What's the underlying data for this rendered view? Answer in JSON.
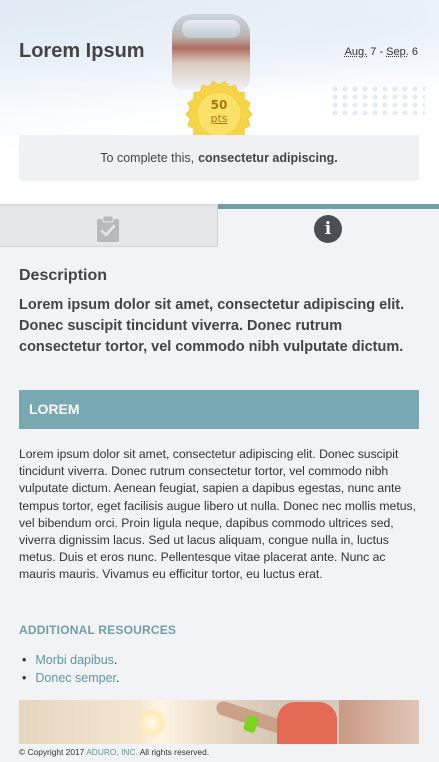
{
  "header": {
    "title": "Lorem Ipsum",
    "date_start_abbr": "Aug.",
    "date_start_day": "7",
    "date_sep": " - ",
    "date_end_abbr": "Sep.",
    "date_end_day": "6"
  },
  "badge": {
    "points": "50",
    "label": "pts"
  },
  "info_box": {
    "prefix": "To complete this,",
    "emphasis": "consectetur adipiscing."
  },
  "tabs": [
    {
      "name": "activity",
      "icon": "clipboard-check-icon",
      "active": false
    },
    {
      "name": "info",
      "icon": "info-icon",
      "glyph": "i",
      "active": true
    }
  ],
  "description": {
    "heading": "Description",
    "text": "Lorem ipsum dolor sit amet, consectetur adipiscing elit. Donec suscipit tincidunt viverra. Donec rutrum consectetur tortor, vel commodo nibh vulputate dictum."
  },
  "section": {
    "banner": "LOREM",
    "body": "Lorem ipsum dolor sit amet, consectetur adipiscing elit. Donec suscipit tincidunt viverra. Donec rutrum consectetur tortor, vel commodo nibh vulputate dictum. Aenean feugiat, sapien a dapibus egestas, nunc ante tempus tortor, eget facilisis augue libero ut nulla. Donec nec mollis metus, vel bibendum orci. Proin ligula neque, dapibus commodo ultrices sed, viverra dignissim lacus. Sed ut lacus aliquam, congue nulla in, luctus metus. Duis et eros nunc. Pellentesque vitae placerat ante. Nunc ac mauris mauris. Vivamus eu efficitur tortor, eu luctus erat."
  },
  "resources": {
    "heading": "ADDITIONAL RESOURCES",
    "links": [
      {
        "label": "Morbi dapibus",
        "suffix": "."
      },
      {
        "label": "Donec semper",
        "suffix": "."
      }
    ]
  },
  "footer": {
    "prefix": "© Copyright 2017",
    "brand": "ADURO, INC.",
    "suffix": "All rights reserved."
  },
  "colors": {
    "accent": "#78a9b3",
    "link": "#5e97a3",
    "badge": "#f5d547",
    "active_tab_border": "#6e9fab"
  }
}
